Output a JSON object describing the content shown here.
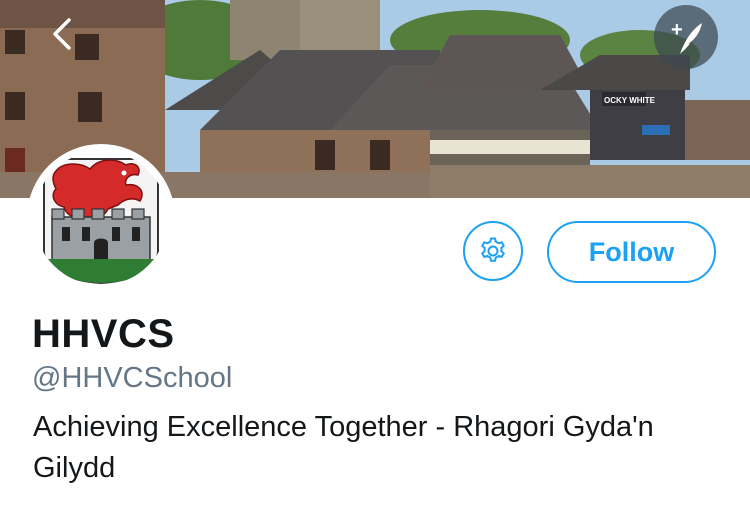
{
  "header": {
    "back_icon": "chevron-left-icon",
    "compose_icon": "compose-tweet-quill-icon",
    "compose_plus": "+",
    "photo_sign_text": "OCKY WHITE"
  },
  "profile": {
    "display_name": "HHVCS",
    "handle": "@HHVCSchool",
    "bio": "Achieving Excellence Together - Rhagori Gyda'n Gilydd",
    "avatar_icon": "school-crest-red-dragon-castle-icon"
  },
  "actions": {
    "settings_icon": "gear-icon",
    "follow_label": "Follow"
  },
  "colors": {
    "accent": "#1da1f2",
    "name_text": "#14171a",
    "handle_text": "#657786",
    "dragon_red": "#d42a2a",
    "castle_grey": "#9aa0a3",
    "grass_green": "#2e7d32"
  }
}
